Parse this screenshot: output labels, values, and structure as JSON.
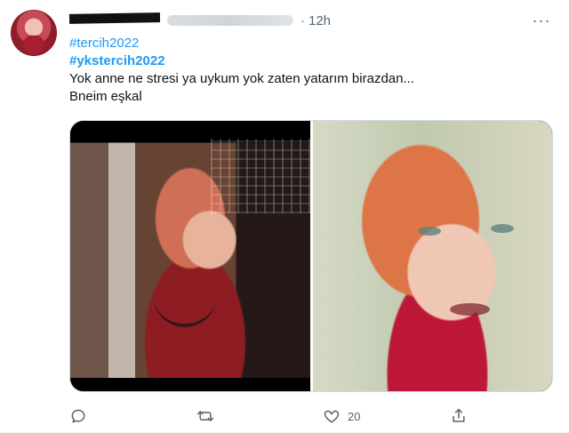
{
  "tweet": {
    "time": "12h",
    "separator": "·",
    "more_label": "···",
    "hashtags": [
      "#tercih2022",
      "#ykstercih2022"
    ],
    "lines": [
      "Yok anne ne stresi ya uykum yok zaten yatarım birazdan...",
      "Bneim eşkal"
    ],
    "actions": {
      "reply_count": "",
      "retweet_count": "",
      "like_count": "20",
      "share_count": ""
    },
    "colors": {
      "hashtag": "#1d9bf0",
      "text": "#0f1419",
      "muted": "#536471",
      "border": "#cfd9de"
    },
    "icons": {
      "reply": "reply-icon",
      "retweet": "retweet-icon",
      "like": "heart-icon",
      "share": "share-icon"
    }
  }
}
